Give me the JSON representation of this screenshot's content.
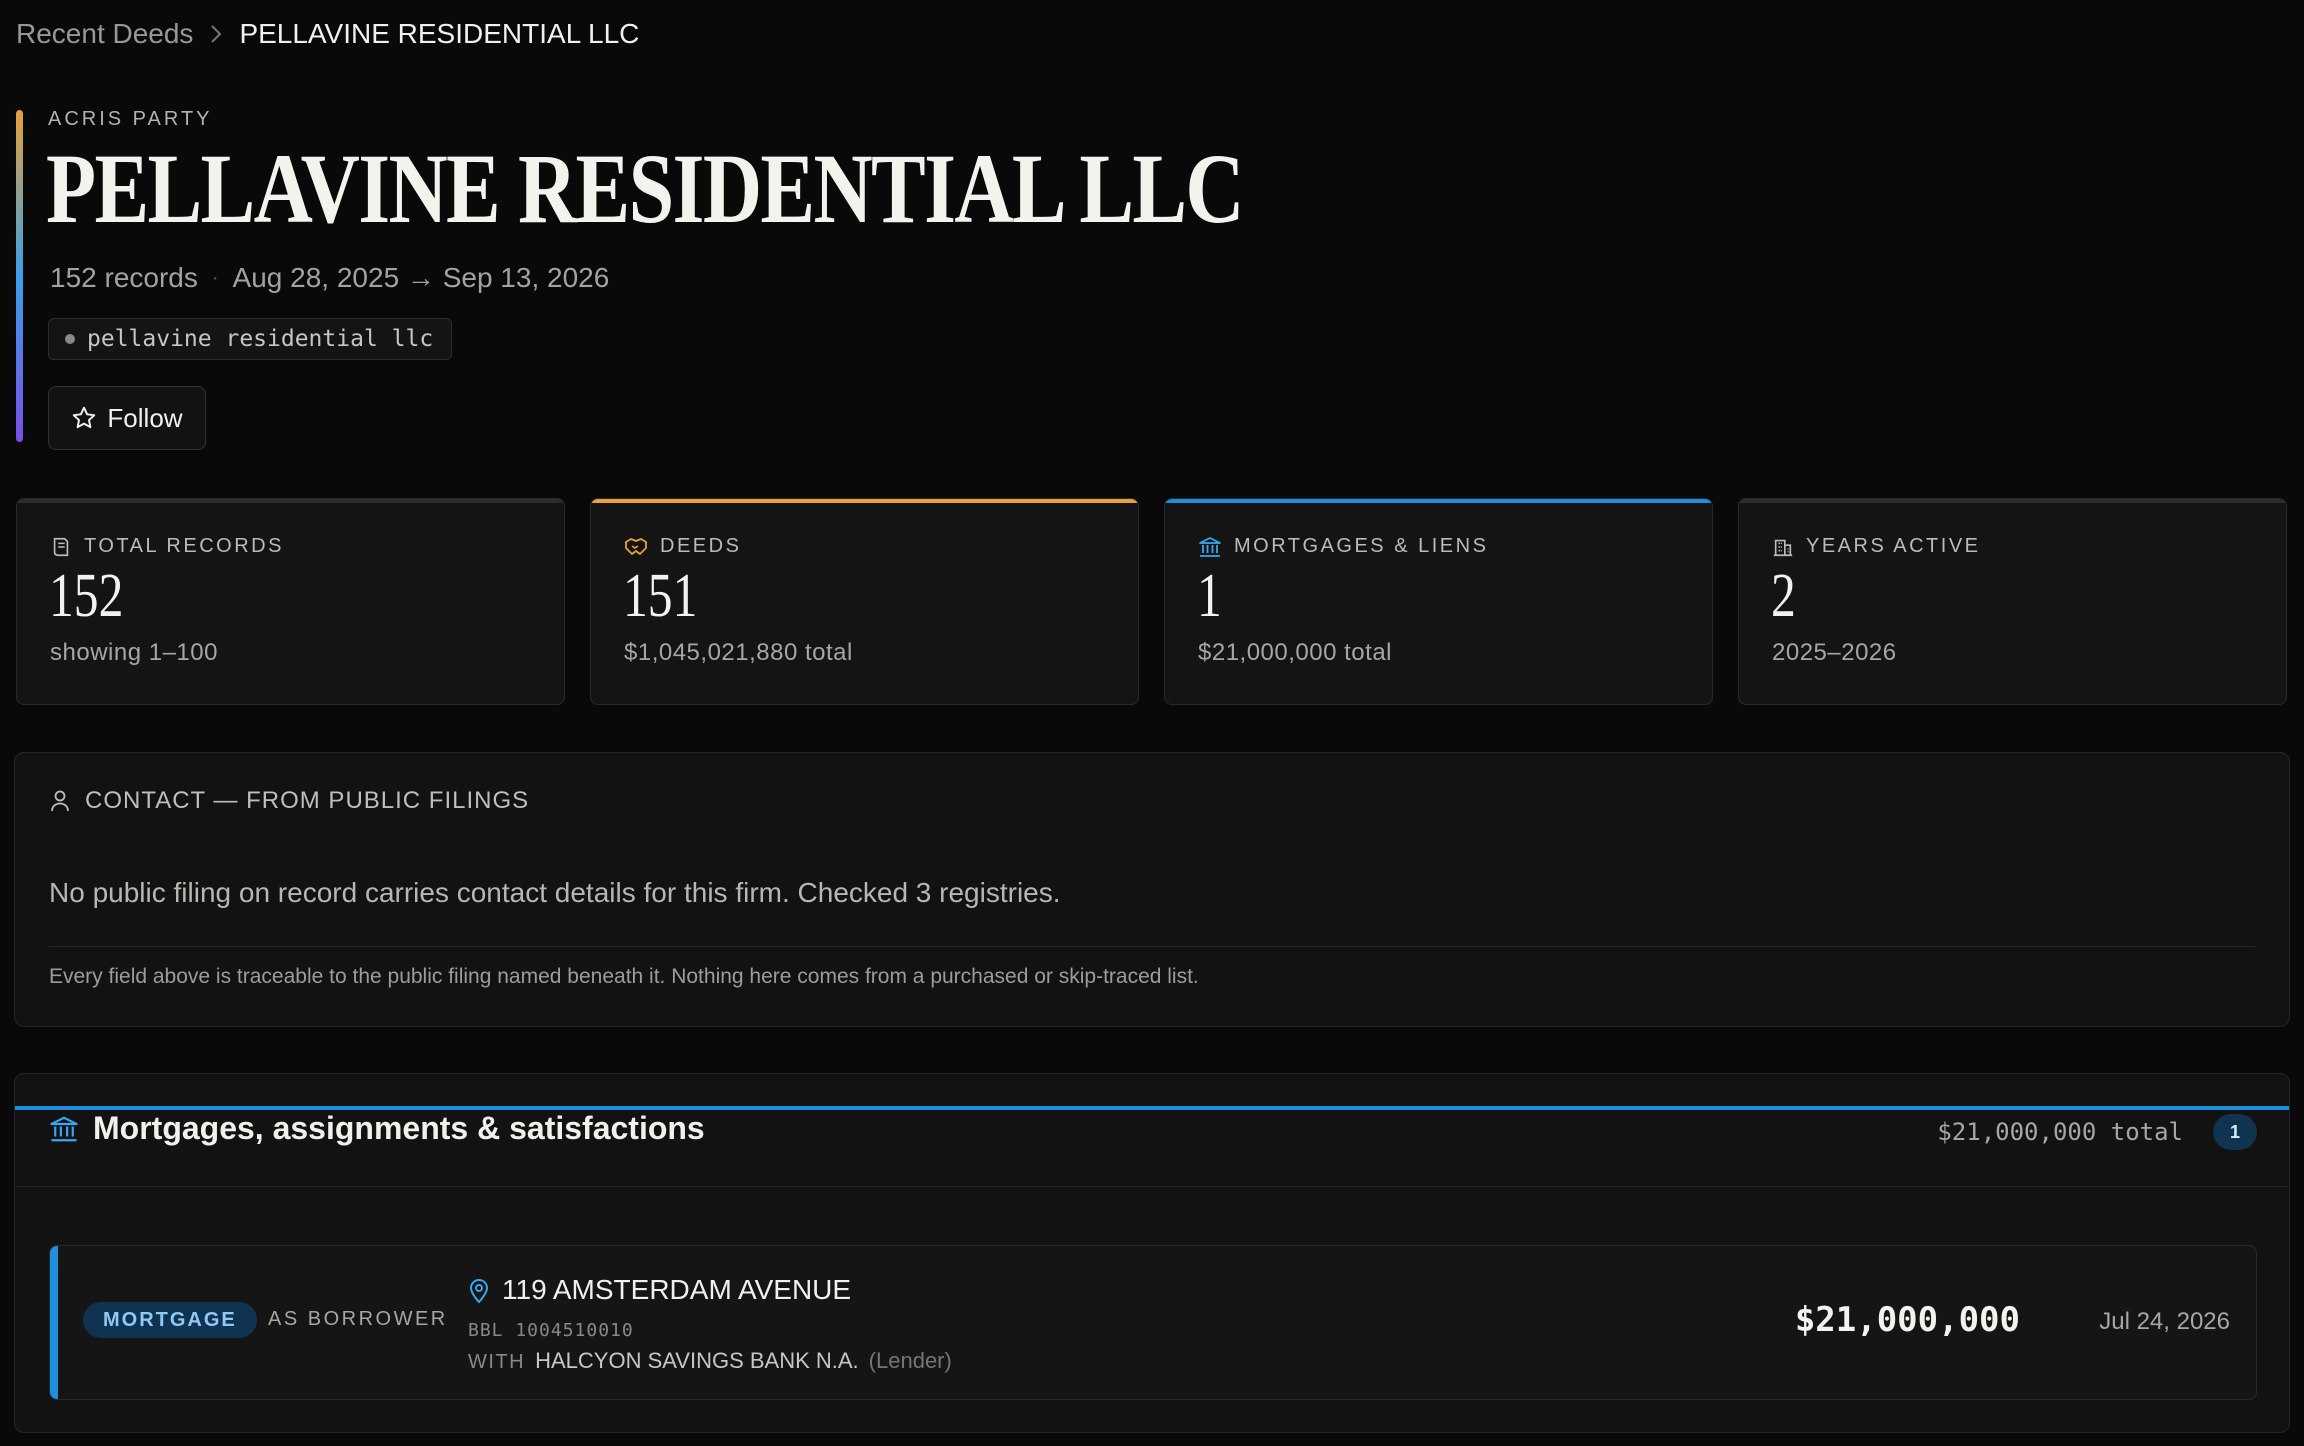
{
  "breadcrumb": {
    "parent": "Recent Deeds",
    "separator": ">",
    "current": "PELLAVINE RESIDENTIAL LLC"
  },
  "header": {
    "eyebrow": "ACRIS PARTY",
    "title": "PELLAVINE RESIDENTIAL LLC",
    "records": "152 records",
    "dot": "·",
    "date_range": "Aug 28, 2025 → Sep 13, 2026",
    "alias": "pellavine residential llc",
    "follow_label": "Follow"
  },
  "stats": [
    {
      "label": "TOTAL RECORDS",
      "value": "152",
      "sub": "showing 1–100",
      "icon": "document-icon",
      "accent": "#2c2c2c"
    },
    {
      "label": "DEEDS",
      "value": "151",
      "sub": "$1,045,021,880 total",
      "icon": "handshake-icon",
      "accent": "#e8a13a"
    },
    {
      "label": "MORTGAGES & LIENS",
      "value": "1",
      "sub": "$21,000,000 total",
      "icon": "bank-icon",
      "accent": "#1f8fdb"
    },
    {
      "label": "YEARS ACTIVE",
      "value": "2",
      "sub": "2025–2026",
      "icon": "building-icon",
      "accent": "#2c2c2c"
    }
  ],
  "contact": {
    "heading": "CONTACT — FROM PUBLIC FILINGS",
    "message": "No public filing on record carries contact details for this firm. Checked 3 registries.",
    "note": "Every field above is traceable to the public filing named beneath it. Nothing here comes from a purchased or skip-traced list."
  },
  "mortgages": {
    "title": "Mortgages, assignments & satisfactions",
    "total": "$21,000,000 total",
    "count": "1",
    "rows": [
      {
        "type": "MORTGAGE",
        "role": "AS BORROWER",
        "address": "119 AMSTERDAM AVENUE",
        "bbl": "BBL 1004510010",
        "with_label": "WITH",
        "counterparty": "HALCYON SAVINGS BANK N.A.",
        "counterparty_role": "(Lender)",
        "amount": "$21,000,000",
        "date": "Jul 24, 2026"
      }
    ]
  },
  "colors": {
    "background": "#090909",
    "deeds_accent": "#e8a13a",
    "mortgage_accent": "#1f8fdb",
    "gradient_end": "#7b4ee8"
  }
}
